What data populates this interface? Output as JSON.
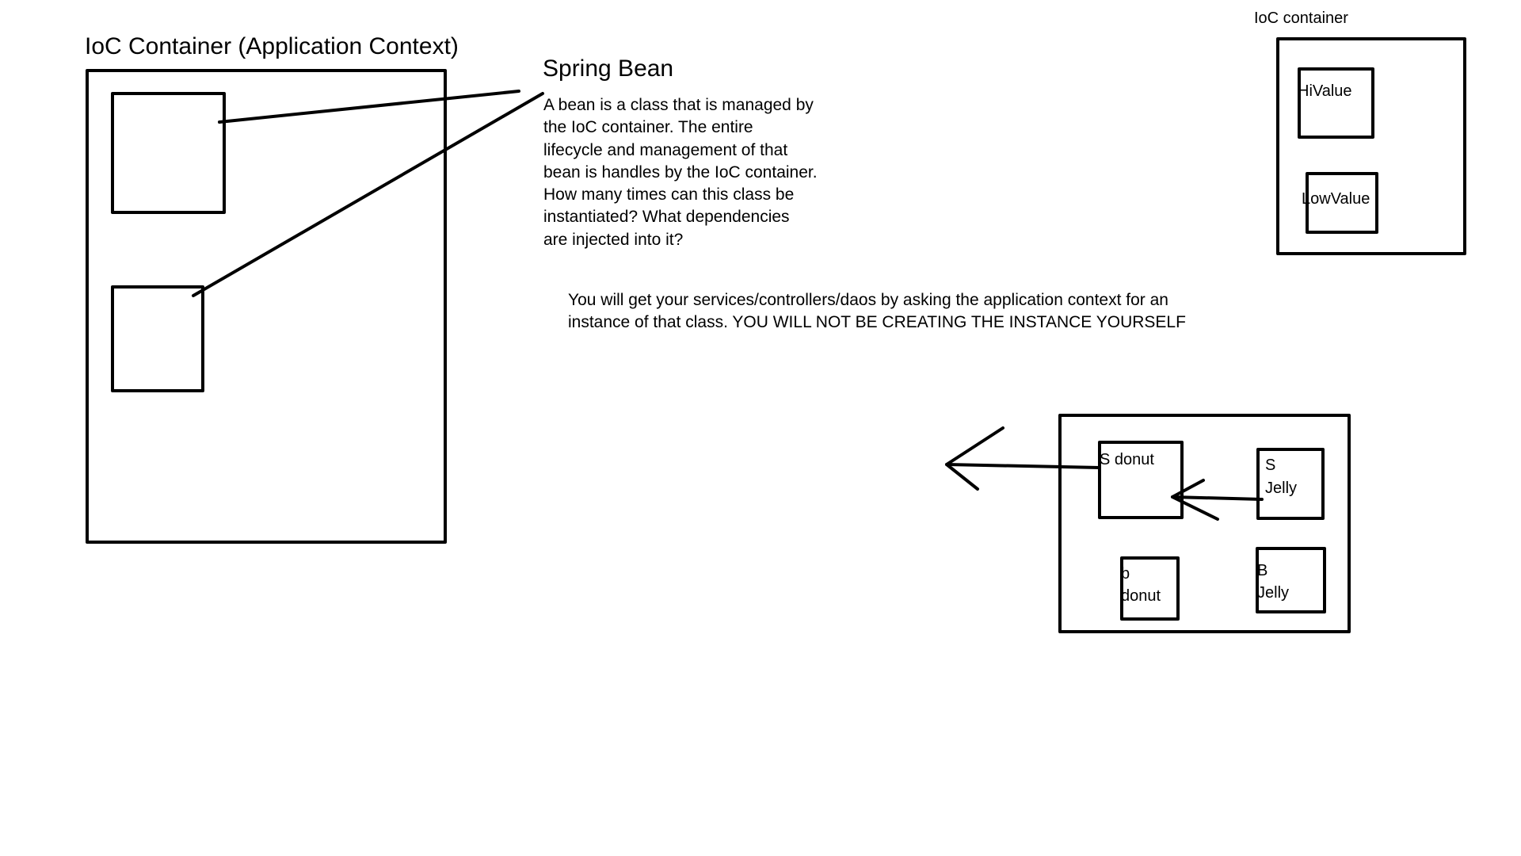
{
  "ioc_container_main": {
    "title": "IoC Container (Application Context)"
  },
  "spring_bean": {
    "title": "Spring Bean",
    "description_lines": [
      "A bean is a class that is managed by",
      "the IoC container. The entire",
      "lifecycle and management of that",
      "bean is handles by the IoC container.",
      "How many times can this class be",
      "instantiated? What dependencies",
      "are injected into it?"
    ]
  },
  "note": {
    "lines": [
      "You will get your services/controllers/daos by asking the application context for an",
      "instance of that class. YOU WILL NOT BE CREATING THE INSTANCE YOURSELF"
    ]
  },
  "ioc_container_small": {
    "title": "IoC container",
    "beans": [
      "HiValue",
      "LowValue"
    ]
  },
  "donut_jelly": {
    "s_donut": "S donut",
    "s_jelly_lines": [
      "S",
      "Jelly"
    ],
    "b_donut_lines": [
      "b",
      "donut"
    ],
    "b_jelly_lines": [
      "B",
      "Jelly"
    ]
  },
  "colors": {
    "ink": "#000000",
    "background": "#ffffff"
  }
}
